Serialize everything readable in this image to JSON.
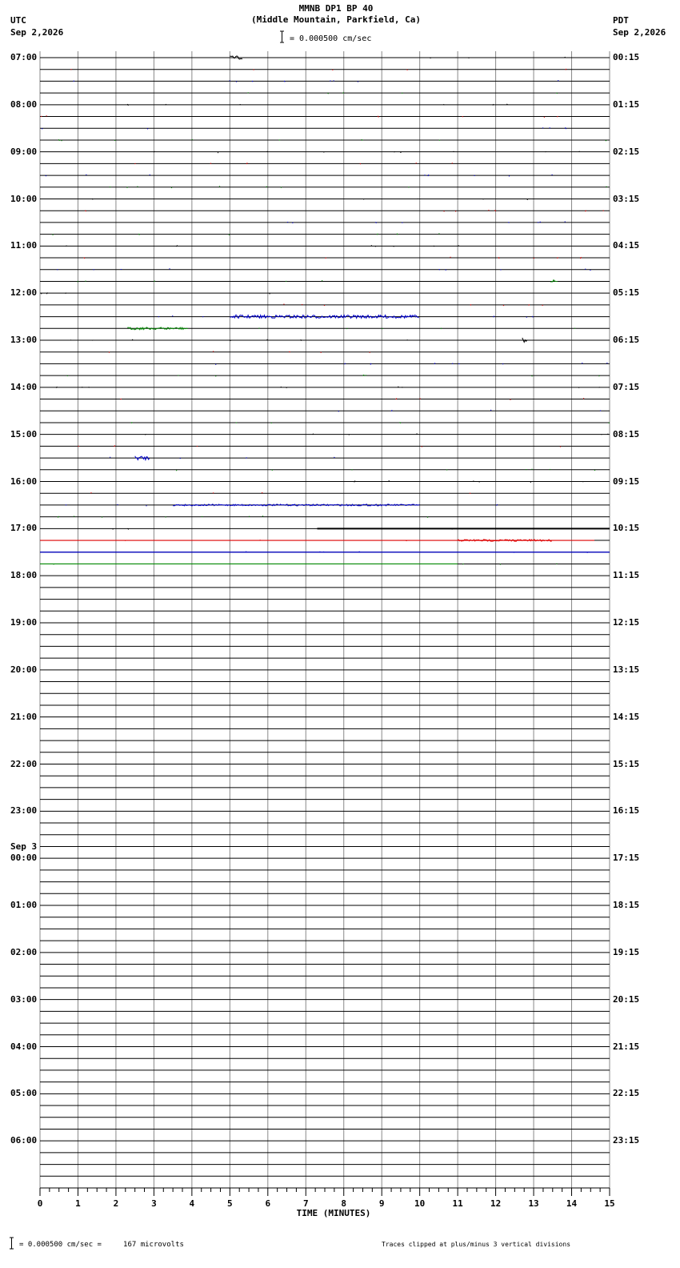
{
  "header": {
    "title": "MMNB DP1 BP 40",
    "subtitle": "(Middle Mountain, Parkfield, Ca)",
    "scale_label": "= 0.000500 cm/sec",
    "left_zone": "UTC",
    "left_date": "Sep 2,2026",
    "right_zone": "PDT",
    "right_date": "Sep 2,2026"
  },
  "footer": {
    "scale_note": "= 0.000500 cm/sec =     167 microvolts",
    "clip_note": "Traces clipped at plus/minus 3 vertical divisions"
  },
  "chart_data": {
    "type": "line",
    "title": "MMNB DP1 BP 40",
    "xlabel": "TIME (MINUTES)",
    "xlim": [
      0,
      15
    ],
    "x_ticks": [
      "0",
      "1",
      "2",
      "3",
      "4",
      "5",
      "6",
      "7",
      "8",
      "9",
      "10",
      "11",
      "12",
      "13",
      "14",
      "15"
    ],
    "traces_per_hour": 4,
    "trace_colors": [
      "#000000",
      "#dd0000",
      "#0000cc",
      "#008800"
    ],
    "left_hour_labels": [
      "07:00",
      "08:00",
      "09:00",
      "10:00",
      "11:00",
      "12:00",
      "13:00",
      "14:00",
      "15:00",
      "16:00",
      "17:00",
      "18:00",
      "19:00",
      "20:00",
      "21:00",
      "22:00",
      "23:00",
      "00:00",
      "01:00",
      "02:00",
      "03:00",
      "04:00",
      "05:00",
      "06:00"
    ],
    "date_change_label": "Sep 3",
    "right_hour_labels": [
      "00:15",
      "01:15",
      "02:15",
      "03:15",
      "04:15",
      "05:15",
      "06:15",
      "07:15",
      "08:15",
      "09:15",
      "10:15",
      "11:15",
      "12:15",
      "13:15",
      "14:15",
      "15:15",
      "16:15",
      "17:15",
      "18:15",
      "19:15",
      "20:15",
      "21:15",
      "22:15",
      "23:15"
    ],
    "last_trace_end": "17:45 UTC",
    "events": [
      {
        "trace_hour": "07:00",
        "trace_index": 0,
        "start_min": 5.0,
        "end_min": 5.35,
        "amplitude": 2
      },
      {
        "trace_hour": "11:00",
        "trace_index": 3,
        "start_min": 13.45,
        "end_min": 13.65,
        "amplitude": 2
      },
      {
        "trace_hour": "12:00",
        "trace_index": 2,
        "start_min": 5.0,
        "end_min": 10.0,
        "amplitude": 2
      },
      {
        "trace_hour": "12:00",
        "trace_index": 3,
        "start_min": 2.3,
        "end_min": 3.9,
        "amplitude": 1.5
      },
      {
        "trace_hour": "13:00",
        "trace_index": 0,
        "start_min": 12.7,
        "end_min": 12.85,
        "amplitude": 3
      },
      {
        "trace_hour": "15:00",
        "trace_index": 2,
        "start_min": 2.5,
        "end_min": 2.9,
        "amplitude": 2.5
      },
      {
        "trace_hour": "16:00",
        "trace_index": 2,
        "start_min": 3.5,
        "end_min": 10.0,
        "amplitude": 1
      },
      {
        "trace_hour": "17:00",
        "trace_index": 1,
        "start_min": 11.0,
        "end_min": 13.5,
        "amplitude": 1.2
      }
    ]
  }
}
